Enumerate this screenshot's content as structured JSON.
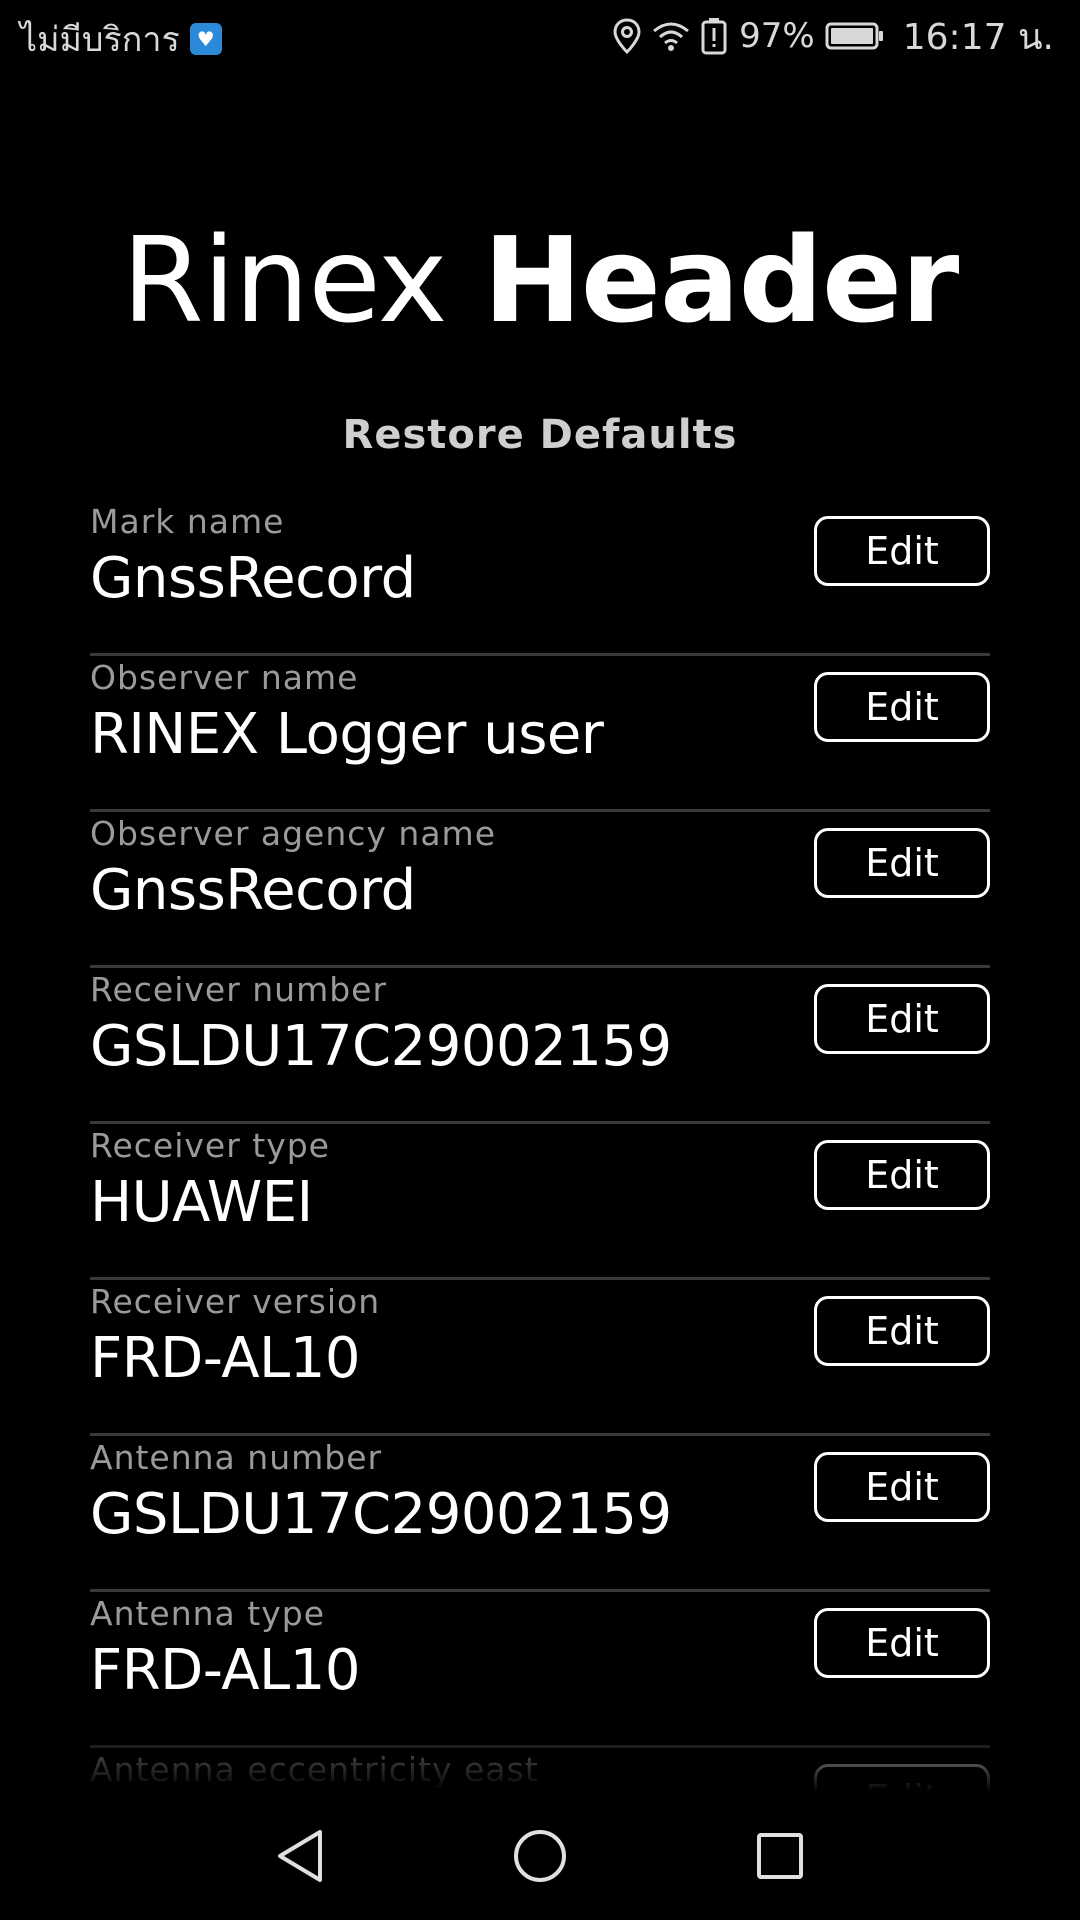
{
  "status_bar": {
    "carrier": "ไม่มีบริการ",
    "battery_percent": "97%",
    "time": "16:17 น.",
    "icons": [
      "app-badge-icon",
      "location-icon",
      "wifi-icon",
      "battery-alert-icon",
      "battery-icon"
    ]
  },
  "title": {
    "light": "Rinex",
    "bold": "Header"
  },
  "restore_defaults_label": "Restore Defaults",
  "edit_label": "Edit",
  "fields": [
    {
      "label": "Mark name",
      "value": "GnssRecord"
    },
    {
      "label": "Observer name",
      "value": "RINEX Logger user"
    },
    {
      "label": "Observer agency name",
      "value": "GnssRecord"
    },
    {
      "label": "Receiver number",
      "value": "GSLDU17C29002159"
    },
    {
      "label": "Receiver type",
      "value": "HUAWEI"
    },
    {
      "label": "Receiver version",
      "value": "FRD-AL10"
    },
    {
      "label": "Antenna number",
      "value": "GSLDU17C29002159"
    },
    {
      "label": "Antenna type",
      "value": "FRD-AL10"
    },
    {
      "label": "Antenna eccentricity east",
      "value": ""
    }
  ],
  "nav_bar": {
    "icons": [
      "back-icon",
      "home-icon",
      "recents-icon"
    ]
  },
  "colors": {
    "background": "#000000",
    "text": "#ffffff",
    "label": "#9a9a9a",
    "divider": "#3a3a3a"
  }
}
